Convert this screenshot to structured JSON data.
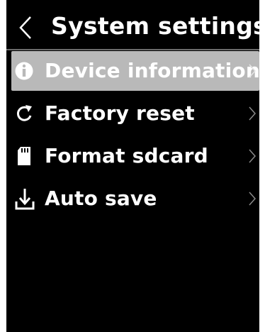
{
  "header": {
    "title": "System settings",
    "back_icon": "chevron-left-icon"
  },
  "menu": {
    "items": [
      {
        "label": "Device information",
        "icon": "info-icon",
        "selected": true
      },
      {
        "label": "Factory reset",
        "icon": "refresh-icon",
        "selected": false
      },
      {
        "label": "Format sdcard",
        "icon": "sdcard-icon",
        "selected": false
      },
      {
        "label": "Auto save",
        "icon": "download-icon",
        "selected": false
      }
    ]
  },
  "colors": {
    "background": "#000000",
    "text": "#ffffff",
    "selected_row": "#b9b9b9",
    "chevron": "#9a9a9a",
    "divider": "#6a6a6a"
  }
}
